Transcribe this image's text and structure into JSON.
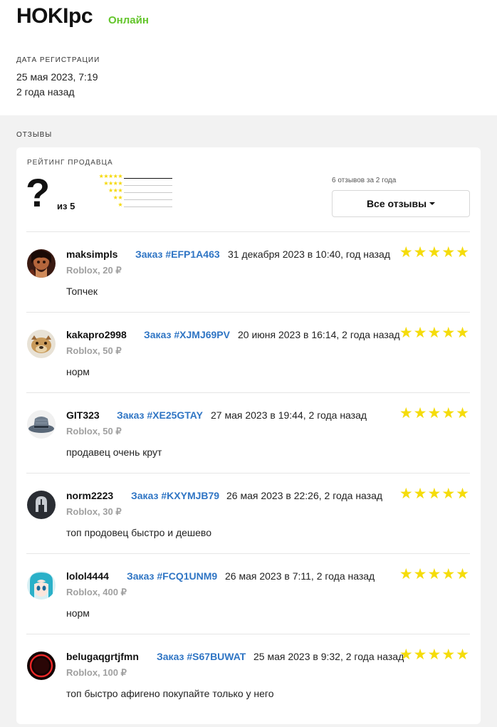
{
  "profile": {
    "name": "HOKIpc",
    "status": "Онлайн",
    "registration_label": "ДАТА РЕГИСТРАЦИИ",
    "registration_date": "25 мая 2023, 7:19",
    "registration_ago": "2 года назад"
  },
  "reviews_section": {
    "label": "ОТЗЫВЫ",
    "rating_label": "РЕЙТИНГ ПРОДАВЦА",
    "rating_value": "?",
    "rating_of": "из 5",
    "summary": "6 отзывов за 2 года",
    "all_reviews_button": "Все отзывы",
    "distribution": [
      {
        "stars": 5,
        "share": 1.0
      },
      {
        "stars": 4,
        "share": 0
      },
      {
        "stars": 3,
        "share": 0
      },
      {
        "stars": 2,
        "share": 0
      },
      {
        "stars": 1,
        "share": 0
      }
    ]
  },
  "reviews": [
    {
      "user": "maksimpls",
      "order": "Заказ #EFP1A463",
      "date": "31 декабря 2023 в 10:40, год назад",
      "product": "Roblox, 20 ₽",
      "text": "Топчек",
      "rating": 5
    },
    {
      "user": "kakapro2998",
      "order": "Заказ #XJMJ69PV",
      "date": "20 июня 2023 в 16:14, 2 года назад",
      "product": "Roblox, 50 ₽",
      "text": "норм",
      "rating": 5
    },
    {
      "user": "GIT323",
      "order": "Заказ #XE25GTAY",
      "date": "27 мая 2023 в 19:44, 2 года назад",
      "product": "Roblox, 50 ₽",
      "text": "продавец очень крут",
      "rating": 5
    },
    {
      "user": "norm2223",
      "order": "Заказ #KXYMJB79",
      "date": "26 мая 2023 в 22:26, 2 года назад",
      "product": "Roblox, 30 ₽",
      "text": "топ продовец быстро и дешево",
      "rating": 5
    },
    {
      "user": "lolol4444",
      "order": "Заказ #FCQ1UNM9",
      "date": "26 мая 2023 в 7:11, 2 года назад",
      "product": "Roblox, 400 ₽",
      "text": "норм",
      "rating": 5
    },
    {
      "user": "belugaqgrtjfmn",
      "order": "Заказ #S67BUWAT",
      "date": "25 мая 2023 в 9:32, 2 года назад",
      "product": "Roblox, 100 ₽",
      "text": "топ быстро афигено покупайте только у него",
      "rating": 5
    }
  ],
  "colors": {
    "online": "#63c52b",
    "order_link": "#2f75c4",
    "star": "#f5dc0a"
  }
}
